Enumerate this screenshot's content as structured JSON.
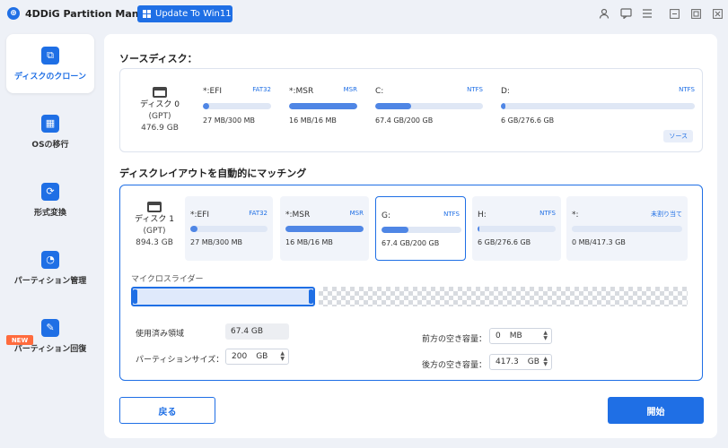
{
  "app": {
    "title": "4DDiG Partition Manager",
    "update_label": "Update To Win11"
  },
  "sidebar": {
    "items": [
      {
        "label": "ディスクのクローン",
        "icon": "disk-clone-icon"
      },
      {
        "label": "OSの移行",
        "icon": "os-migration-icon"
      },
      {
        "label": "形式変換",
        "icon": "format-convert-icon"
      },
      {
        "label": "パーティション管理",
        "icon": "partition-manage-icon"
      },
      {
        "label": "パーティション回復",
        "icon": "partition-recovery-icon"
      }
    ],
    "new_badge": "NEW"
  },
  "source": {
    "title": "ソースディスク：",
    "disk": {
      "name": "ディスク 0",
      "type": "(GPT)",
      "size": "476.9 GB"
    },
    "partitions": [
      {
        "name": "*:EFI",
        "fs": "FAT32",
        "size": "27 MB/300 MB",
        "used": 0.09
      },
      {
        "name": "*:MSR",
        "fs": "MSR",
        "size": "16 MB/16 MB",
        "used": 1.0
      },
      {
        "name": "C:",
        "fs": "NTFS",
        "size": "67.4 GB/200 GB",
        "used": 0.337
      },
      {
        "name": "D:",
        "fs": "NTFS",
        "size": "6 GB/276.6 GB",
        "used": 0.022
      }
    ],
    "tag": "ソース"
  },
  "target": {
    "title": "ディスクレイアウトを自動的にマッチング",
    "disk": {
      "name": "ディスク 1",
      "type": "(GPT)",
      "size": "894.3 GB"
    },
    "partitions": [
      {
        "name": "*:EFI",
        "fs": "FAT32",
        "size": "27 MB/300 MB",
        "used": 0.09
      },
      {
        "name": "*:MSR",
        "fs": "MSR",
        "size": "16 MB/16 MB",
        "used": 1.0
      },
      {
        "name": "G:",
        "fs": "NTFS",
        "size": "67.4 GB/200 GB",
        "used": 0.337
      },
      {
        "name": "H:",
        "fs": "NTFS",
        "size": "6 GB/276.6 GB",
        "used": 0.022
      },
      {
        "name": "*:",
        "fs": "未割り当て",
        "size": "0 MB/417.3 GB",
        "used": 0
      }
    ]
  },
  "micro_slider": {
    "label": "マイクロスライダー",
    "position": 0.33
  },
  "fields": {
    "used_label": "使用済み領域",
    "used_value": "67.4 GB",
    "partition_size_label": "パーティションサイズ：",
    "partition_size_value": "200",
    "partition_size_unit": "GB",
    "free_before_label": "前方の空き容量：",
    "free_before_value": "0",
    "free_before_unit": "MB",
    "free_after_label": "後方の空き容量：",
    "free_after_value": "417.3",
    "free_after_unit": "GB"
  },
  "buttons": {
    "back": "戻る",
    "start": "開始"
  }
}
